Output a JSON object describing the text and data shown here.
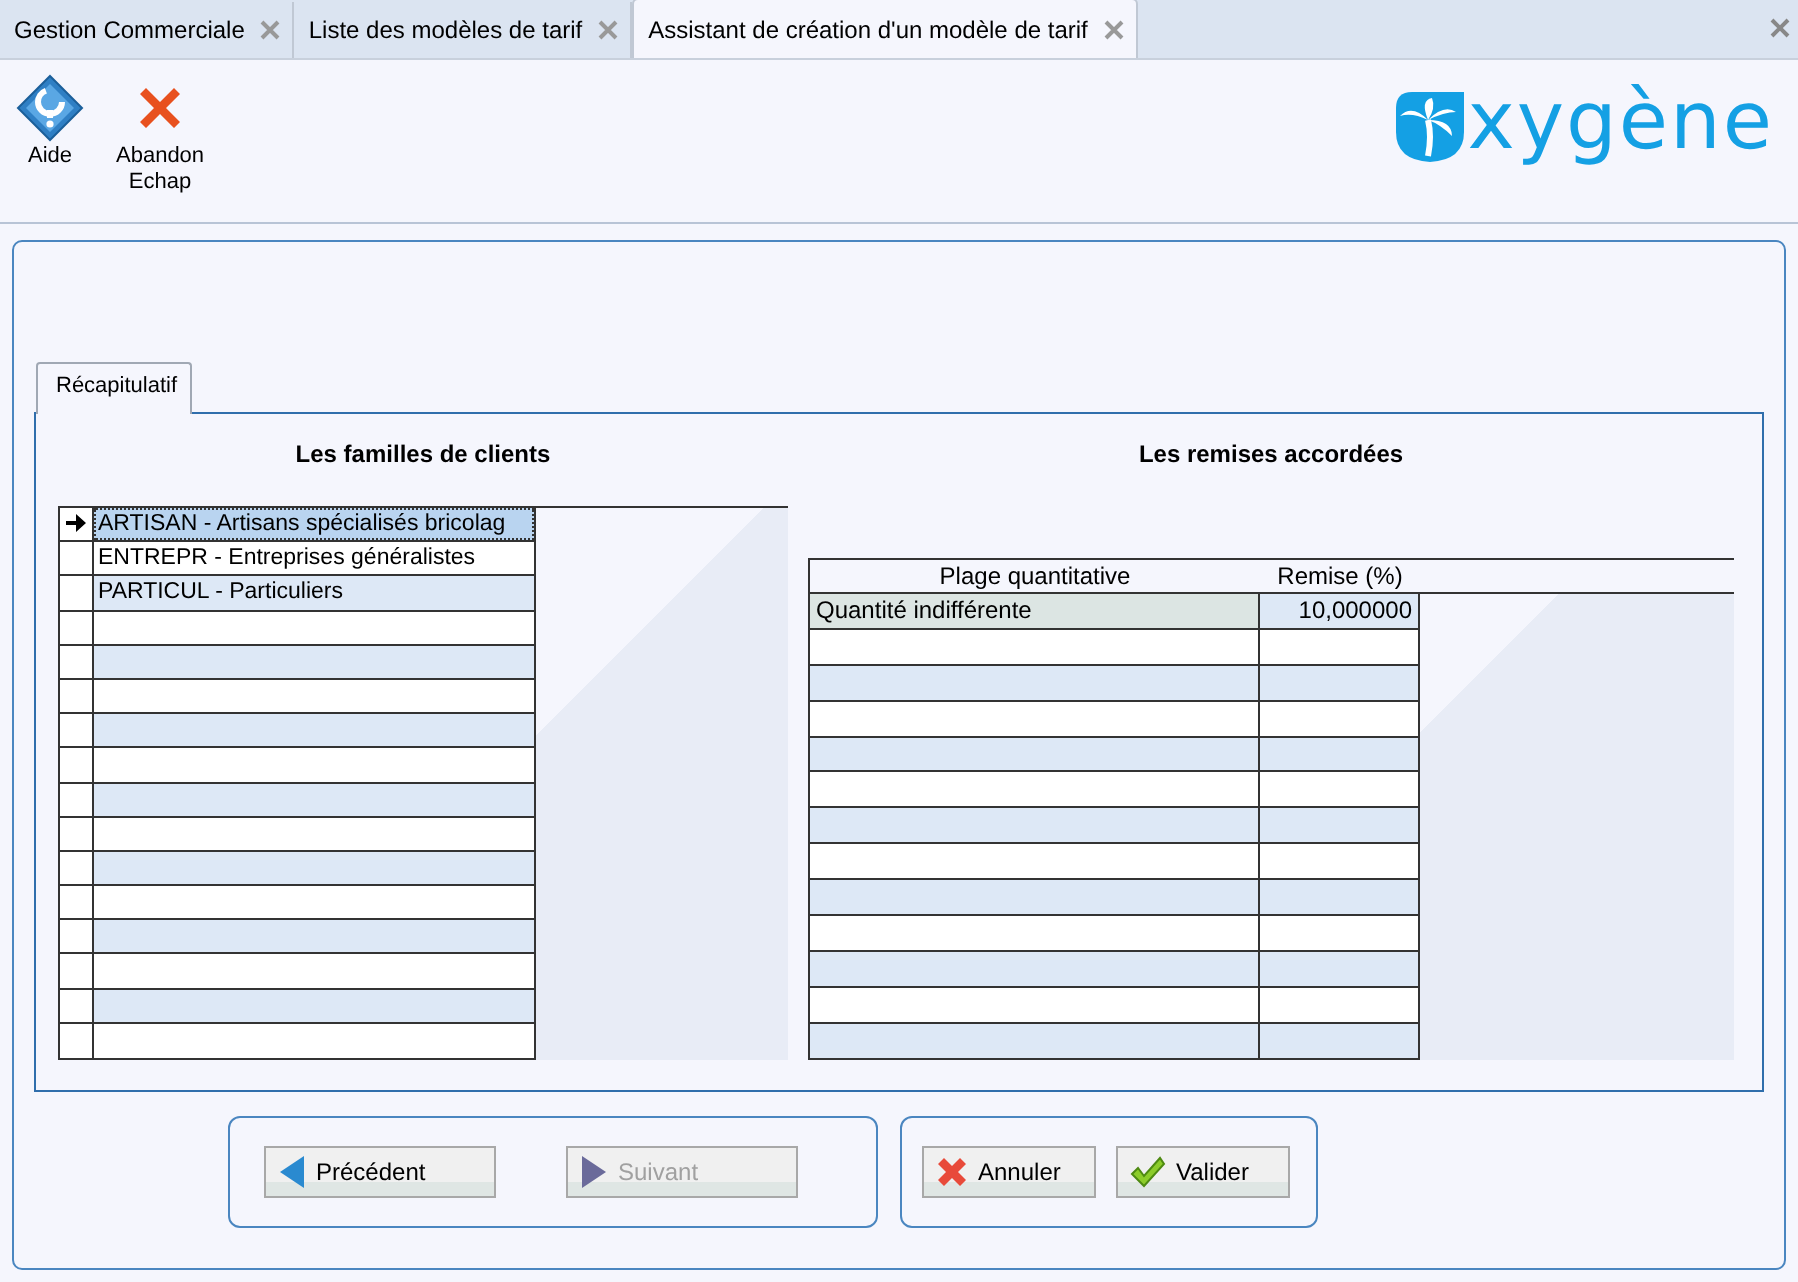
{
  "tabs": [
    {
      "label": "Gestion Commerciale",
      "selected": false
    },
    {
      "label": "Liste des modèles de tarif",
      "selected": false
    },
    {
      "label": "Assistant de création d'un modèle de tarif",
      "selected": true
    }
  ],
  "toolbar": [
    {
      "kind": "help",
      "label": "Aide"
    },
    {
      "kind": "abandon",
      "label": "Abandon\nEchap"
    }
  ],
  "logo": {
    "text": "xygène"
  },
  "wizard_tab": {
    "label": "Récapitulatif"
  },
  "families": {
    "title": "Les familles de clients",
    "rows": [
      {
        "label": "ARTISAN - Artisans spécialisés bricolag",
        "selected": true
      },
      {
        "label": "ENTREPR - Entreprises généralistes",
        "selected": false
      },
      {
        "label": "PARTICUL - Particuliers",
        "selected": false
      }
    ]
  },
  "discounts": {
    "title": "Les remises accordées",
    "columns": [
      "Plage quantitative",
      "Remise (%)"
    ],
    "rows": [
      {
        "cells": [
          "Quantité indifférente",
          "10,000000"
        ],
        "selected": true
      }
    ]
  },
  "buttons": [
    {
      "kind": "previous",
      "label": "Précédent",
      "disabled": false
    },
    {
      "kind": "next",
      "label": "Suivant",
      "disabled": true
    },
    {
      "kind": "cancel",
      "label": "Annuler",
      "disabled": false
    },
    {
      "kind": "validate",
      "label": "Valider",
      "disabled": false
    }
  ]
}
